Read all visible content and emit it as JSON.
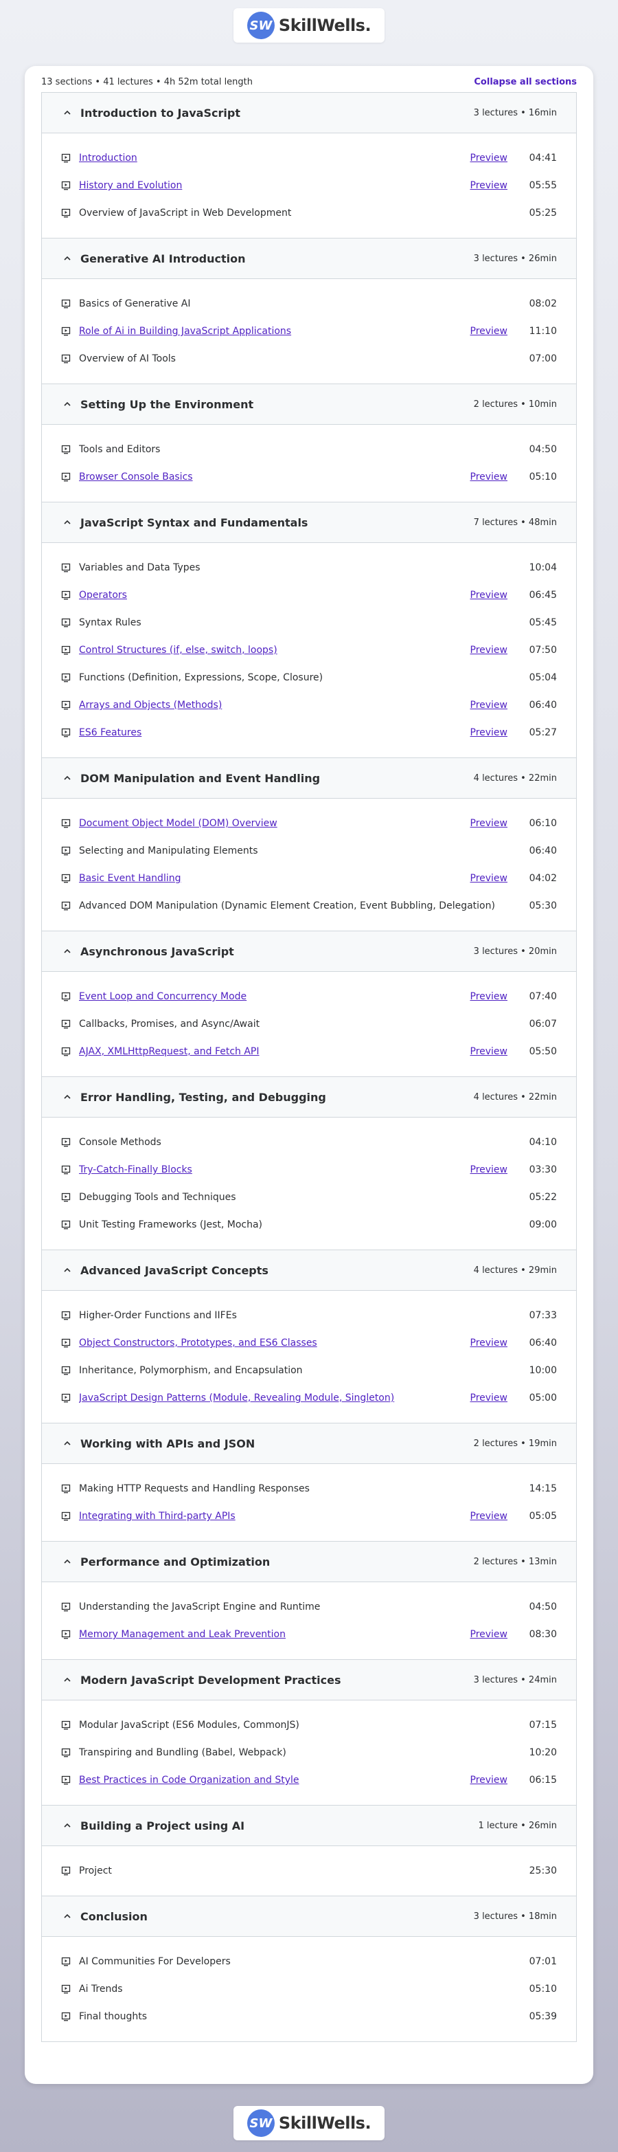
{
  "brand": {
    "mark": "SW",
    "name": "SkillWells."
  },
  "summary": {
    "text": "13 sections • 41 lectures • 4h 52m total length",
    "collapse_label": "Collapse all sections"
  },
  "preview_label": "Preview",
  "colors": {
    "accent": "#5022c3",
    "section_bg": "#f7f9fa",
    "border": "#d1d7dc"
  },
  "sections": [
    {
      "title": "Introduction to JavaScript",
      "meta": "3 lectures • 16min",
      "lectures": [
        {
          "title": "Introduction",
          "link": true,
          "preview": true,
          "duration": "04:41"
        },
        {
          "title": "History and Evolution",
          "link": true,
          "preview": true,
          "duration": "05:55"
        },
        {
          "title": "Overview of JavaScript in Web Development",
          "link": false,
          "preview": false,
          "duration": "05:25"
        }
      ]
    },
    {
      "title": "Generative AI Introduction",
      "meta": "3 lectures • 26min",
      "lectures": [
        {
          "title": "Basics of Generative AI",
          "link": false,
          "preview": false,
          "duration": "08:02"
        },
        {
          "title": "Role of Ai in Building JavaScript Applications",
          "link": true,
          "preview": true,
          "duration": "11:10"
        },
        {
          "title": "Overview of AI Tools",
          "link": false,
          "preview": false,
          "duration": "07:00"
        }
      ]
    },
    {
      "title": "Setting Up the Environment",
      "meta": "2 lectures • 10min",
      "lectures": [
        {
          "title": "Tools and Editors",
          "link": false,
          "preview": false,
          "duration": "04:50"
        },
        {
          "title": "Browser Console Basics",
          "link": true,
          "preview": true,
          "duration": "05:10"
        }
      ]
    },
    {
      "title": "JavaScript Syntax and Fundamentals",
      "meta": "7 lectures • 48min",
      "lectures": [
        {
          "title": "Variables and Data Types",
          "link": false,
          "preview": false,
          "duration": "10:04"
        },
        {
          "title": "Operators",
          "link": true,
          "preview": true,
          "duration": "06:45"
        },
        {
          "title": "Syntax Rules",
          "link": false,
          "preview": false,
          "duration": "05:45"
        },
        {
          "title": "Control Structures (if, else, switch, loops)",
          "link": true,
          "preview": true,
          "duration": "07:50"
        },
        {
          "title": "Functions (Definition, Expressions, Scope, Closure)",
          "link": false,
          "preview": false,
          "duration": "05:04"
        },
        {
          "title": "Arrays and Objects (Methods)",
          "link": true,
          "preview": true,
          "duration": "06:40"
        },
        {
          "title": "ES6 Features",
          "link": true,
          "preview": true,
          "duration": "05:27"
        }
      ]
    },
    {
      "title": "DOM Manipulation and Event Handling",
      "meta": "4 lectures • 22min",
      "lectures": [
        {
          "title": "Document Object Model (DOM) Overview",
          "link": true,
          "preview": true,
          "duration": "06:10"
        },
        {
          "title": "Selecting and Manipulating Elements",
          "link": false,
          "preview": false,
          "duration": "06:40"
        },
        {
          "title": "Basic Event Handling",
          "link": true,
          "preview": true,
          "duration": "04:02"
        },
        {
          "title": "Advanced DOM Manipulation (Dynamic Element Creation, Event Bubbling, Delegation)",
          "link": false,
          "preview": false,
          "duration": "05:30"
        }
      ]
    },
    {
      "title": "Asynchronous JavaScript",
      "meta": "3 lectures • 20min",
      "lectures": [
        {
          "title": "Event Loop and Concurrency Mode",
          "link": true,
          "preview": true,
          "duration": "07:40"
        },
        {
          "title": "Callbacks, Promises, and Async/Await",
          "link": false,
          "preview": false,
          "duration": "06:07"
        },
        {
          "title": "AJAX, XMLHttpRequest, and Fetch API",
          "link": true,
          "preview": true,
          "duration": "05:50"
        }
      ]
    },
    {
      "title": "Error Handling, Testing, and Debugging",
      "meta": "4 lectures • 22min",
      "lectures": [
        {
          "title": "Console Methods",
          "link": false,
          "preview": false,
          "duration": "04:10"
        },
        {
          "title": "Try-Catch-Finally Blocks",
          "link": true,
          "preview": true,
          "duration": "03:30"
        },
        {
          "title": "Debugging Tools and Techniques",
          "link": false,
          "preview": false,
          "duration": "05:22"
        },
        {
          "title": "Unit Testing Frameworks (Jest, Mocha)",
          "link": false,
          "preview": false,
          "duration": "09:00"
        }
      ]
    },
    {
      "title": "Advanced JavaScript Concepts",
      "meta": "4 lectures • 29min",
      "lectures": [
        {
          "title": "Higher-Order Functions and IIFEs",
          "link": false,
          "preview": false,
          "duration": "07:33"
        },
        {
          "title": "Object Constructors, Prototypes, and ES6 Classes",
          "link": true,
          "preview": true,
          "duration": "06:40"
        },
        {
          "title": "Inheritance, Polymorphism, and Encapsulation",
          "link": false,
          "preview": false,
          "duration": "10:00"
        },
        {
          "title": "JavaScript Design Patterns (Module, Revealing Module, Singleton)",
          "link": true,
          "preview": true,
          "duration": "05:00"
        }
      ]
    },
    {
      "title": "Working with APIs and JSON",
      "meta": "2 lectures • 19min",
      "lectures": [
        {
          "title": "Making HTTP Requests and Handling Responses",
          "link": false,
          "preview": false,
          "duration": "14:15"
        },
        {
          "title": "Integrating with Third-party APIs",
          "link": true,
          "preview": true,
          "duration": "05:05"
        }
      ]
    },
    {
      "title": "Performance and Optimization",
      "meta": "2 lectures • 13min",
      "lectures": [
        {
          "title": "Understanding the JavaScript Engine and Runtime",
          "link": false,
          "preview": false,
          "duration": "04:50"
        },
        {
          "title": "Memory Management and Leak Prevention",
          "link": true,
          "preview": true,
          "duration": "08:30"
        }
      ]
    },
    {
      "title": "Modern JavaScript Development Practices",
      "meta": "3 lectures • 24min",
      "lectures": [
        {
          "title": "Modular JavaScript (ES6 Modules, CommonJS)",
          "link": false,
          "preview": false,
          "duration": "07:15"
        },
        {
          "title": "Transpiring and Bundling (Babel, Webpack)",
          "link": false,
          "preview": false,
          "duration": "10:20"
        },
        {
          "title": "Best Practices in Code Organization and Style",
          "link": true,
          "preview": true,
          "duration": "06:15"
        }
      ]
    },
    {
      "title": "Building a Project using AI",
      "meta": "1 lecture • 26min",
      "lectures": [
        {
          "title": "Project",
          "link": false,
          "preview": false,
          "duration": "25:30"
        }
      ]
    },
    {
      "title": "Conclusion",
      "meta": "3 lectures • 18min",
      "lectures": [
        {
          "title": "AI Communities For Developers",
          "link": false,
          "preview": false,
          "duration": "07:01"
        },
        {
          "title": "Ai Trends",
          "link": false,
          "preview": false,
          "duration": "05:10"
        },
        {
          "title": "Final thoughts",
          "link": false,
          "preview": false,
          "duration": "05:39"
        }
      ]
    }
  ]
}
